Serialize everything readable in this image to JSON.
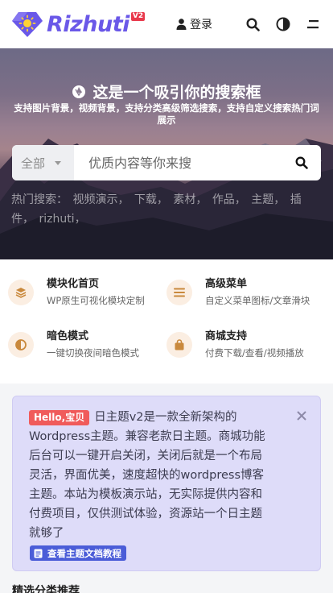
{
  "header": {
    "logo_text": "Rizhuti",
    "logo_badge": "V2",
    "login_label": "登录",
    "icons": [
      "user-icon",
      "search-icon",
      "theme-toggle-icon",
      "menu-icon"
    ]
  },
  "hero": {
    "title": "这是一个吸引你的搜索框",
    "subtitle": "支持图片背景，视频背景，支持分类高级筛选搜索，支持自定义搜索热门词展示",
    "search": {
      "category": "全部",
      "placeholder": "优质内容等你来搜"
    },
    "hot_label": "热门搜索：",
    "hot_terms": [
      "视频演示，",
      "下载，",
      "素材，",
      "作品，",
      "主题，",
      "插件，",
      "rizhuti，"
    ]
  },
  "features": [
    {
      "title": "模块化首页",
      "desc": "WP原生可视化模块定制",
      "icon": "layers-icon"
    },
    {
      "title": "高级菜单",
      "desc": "自定义菜单图标/文章滑块",
      "icon": "menu-lines-icon"
    },
    {
      "title": "暗色模式",
      "desc": "一键切换夜间暗色模式",
      "icon": "half-circle-icon"
    },
    {
      "title": "商城支持",
      "desc": "付费下载/查看/视频播放",
      "icon": "shopping-bag-icon"
    }
  ],
  "notice": {
    "tag": "Hello,宝贝",
    "text": "日主题v2是一款全新架构的Wordpress主题。兼容老款日主题。商城功能后台可以一键开启关闭，关闭后就是一个布局灵活，界面优美，速度超快的wordpress博客主题。本站为模板演示站，无实际提供内容和付费项目，仅供测试体验，资源站一个日主题就够了",
    "link_label": "查看主题文档教程"
  },
  "section": {
    "title": "精选分类推荐"
  },
  "colors": {
    "brand": "#6a58e8",
    "badge": "#e9384b",
    "notice_bg": "#dedcf9",
    "notice_tag": "#f05b5b",
    "notice_link": "#4b5dd8",
    "feature_icon": "#c9893d"
  }
}
